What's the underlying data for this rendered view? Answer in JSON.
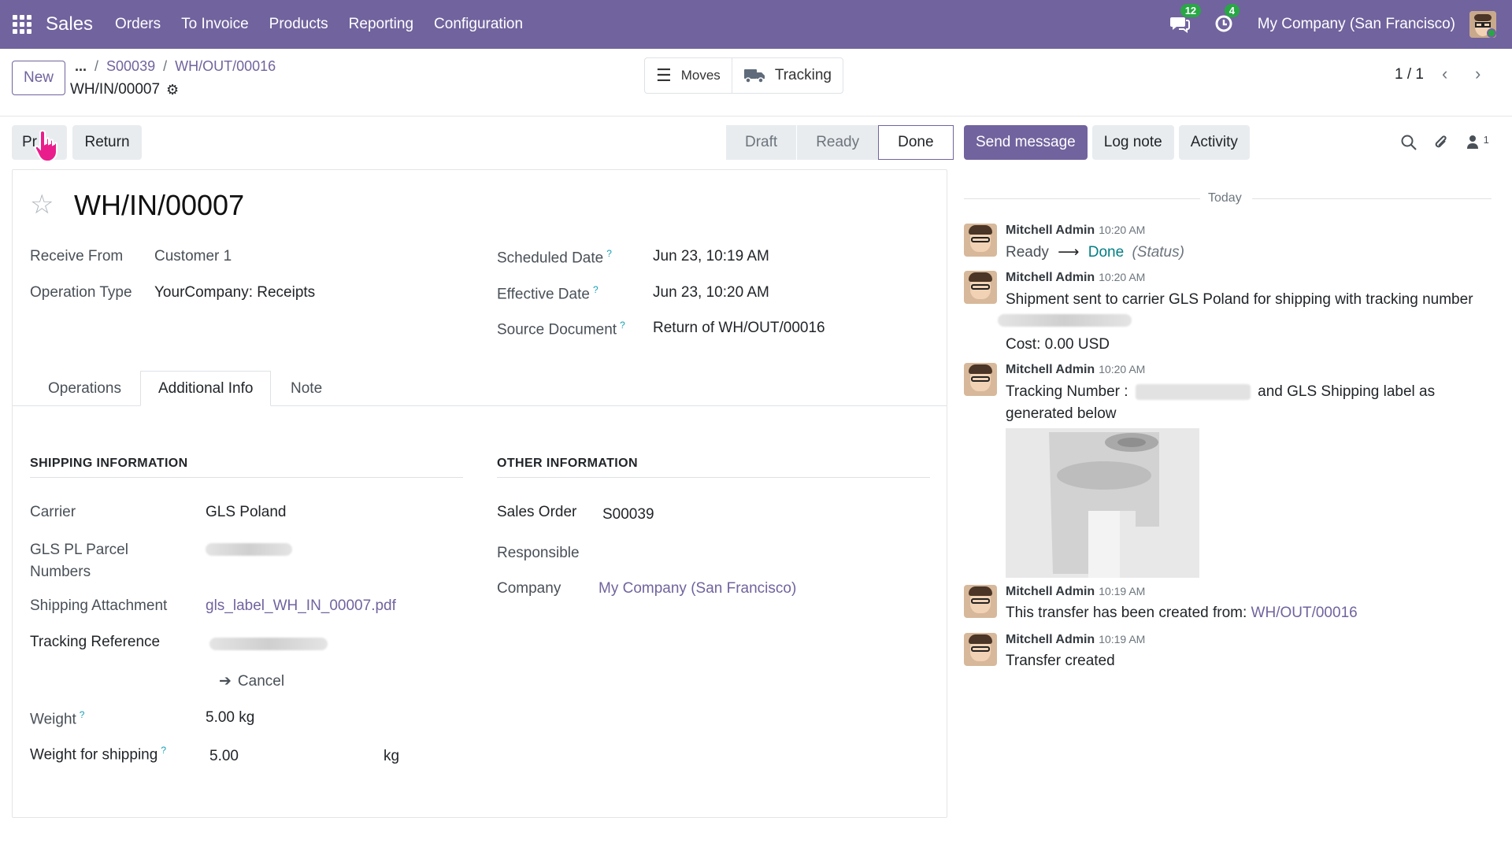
{
  "navbar": {
    "app_name": "Sales",
    "menu": [
      "Orders",
      "To Invoice",
      "Products",
      "Reporting",
      "Configuration"
    ],
    "messages_count": "12",
    "activities_count": "4",
    "company": "My Company (San Francisco)"
  },
  "control": {
    "new_label": "New",
    "breadcrumb_ellipsis": "...",
    "breadcrumb": [
      "S00039",
      "WH/OUT/00016"
    ],
    "record_name": "WH/IN/00007",
    "moves_label": "Moves",
    "tracking_label": "Tracking",
    "pager": "1 / 1"
  },
  "actions": {
    "print_label": "Pr",
    "return_label": "Return",
    "status_steps": [
      "Draft",
      "Ready",
      "Done"
    ],
    "active_status": "Done"
  },
  "form": {
    "title": "WH/IN/00007",
    "receive_from_label": "Receive From",
    "receive_from": "Customer 1",
    "operation_type_label": "Operation Type",
    "operation_type": "YourCompany: Receipts",
    "scheduled_date_label": "Scheduled Date",
    "scheduled_date": "Jun 23, 10:19 AM",
    "effective_date_label": "Effective Date",
    "effective_date": "Jun 23, 10:20 AM",
    "source_document_label": "Source Document",
    "source_document": "Return of WH/OUT/00016",
    "help_mark": "?",
    "tabs": [
      "Operations",
      "Additional Info",
      "Note"
    ],
    "active_tab": "Additional Info",
    "shipping": {
      "section_title": "SHIPPING INFORMATION",
      "carrier_label": "Carrier",
      "carrier": "GLS Poland",
      "parcel_label_1": "GLS PL Parcel",
      "parcel_label_2": "Numbers",
      "attachment_label": "Shipping Attachment",
      "attachment": "gls_label_WH_IN_00007.pdf",
      "tracking_ref_label": "Tracking Reference",
      "cancel_label": "Cancel",
      "weight_label": "Weight",
      "weight": "5.00",
      "weight_unit": "kg",
      "weight_shipping_label": "Weight for shipping",
      "weight_shipping": "5.00",
      "weight_shipping_unit": "kg"
    },
    "other": {
      "section_title": "OTHER INFORMATION",
      "sales_order_label": "Sales Order",
      "sales_order": "S00039",
      "responsible_label": "Responsible",
      "company_label": "Company",
      "company": "My Company (San Francisco)"
    }
  },
  "chatter": {
    "send_message": "Send message",
    "log_note": "Log note",
    "activity": "Activity",
    "followers_count": "1",
    "today": "Today",
    "messages": [
      {
        "author": "Mitchell Admin",
        "time": "10:20 AM",
        "from": "Ready",
        "arrow": "⟶",
        "to": "Done",
        "field": "(Status)"
      },
      {
        "author": "Mitchell Admin",
        "time": "10:20 AM",
        "text": "Shipment sent to carrier GLS Poland for shipping with tracking number",
        "cost": "Cost: 0.00 USD"
      },
      {
        "author": "Mitchell Admin",
        "time": "10:20 AM",
        "text_a": "Tracking Number :",
        "text_b": "and GLS Shipping label as",
        "text_c": "generated below"
      },
      {
        "author": "Mitchell Admin",
        "time": "10:19 AM",
        "text": "This transfer has been created from:",
        "link": "WH/OUT/00016"
      },
      {
        "author": "Mitchell Admin",
        "time": "10:19 AM",
        "text": "Transfer created"
      }
    ]
  },
  "colors": {
    "brand": "#71639e",
    "success": "#28a745",
    "done_link": "#017e84"
  },
  "icons": [
    "apps-grid-icon",
    "chat-icon",
    "clock-icon",
    "gear-icon",
    "list-icon",
    "truck-icon",
    "star-icon",
    "arrow-right-icon",
    "search-icon",
    "paperclip-icon",
    "user-icon",
    "chevron-left-icon",
    "chevron-right-icon",
    "hand-cursor-icon"
  ]
}
